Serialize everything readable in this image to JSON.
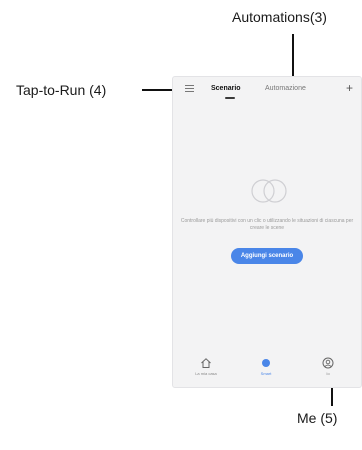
{
  "callouts": {
    "automations": "Automations(3)",
    "tap_to_run": "Tap-to-Run (4)",
    "me": "Me (5)"
  },
  "app": {
    "tabs": [
      "Scenario",
      "Automazione"
    ],
    "active_tab": 0,
    "empty_message": "Controllare più dispositivi con un clic o utilizzando le situazioni di ciascuna per creare le scene",
    "add_button": "Aggiungi scenario",
    "bottom_nav": [
      "La mia casa",
      "Smart",
      "Io"
    ],
    "active_nav": 1,
    "icons": [
      "menu-icon",
      "plus-icon",
      "empty-scene-icon",
      "home-icon",
      "smart-icon",
      "profile-icon"
    ]
  },
  "colors": {
    "accent": "#4a86e8",
    "callout_line": "#111111",
    "background": "#f3f3f4"
  }
}
